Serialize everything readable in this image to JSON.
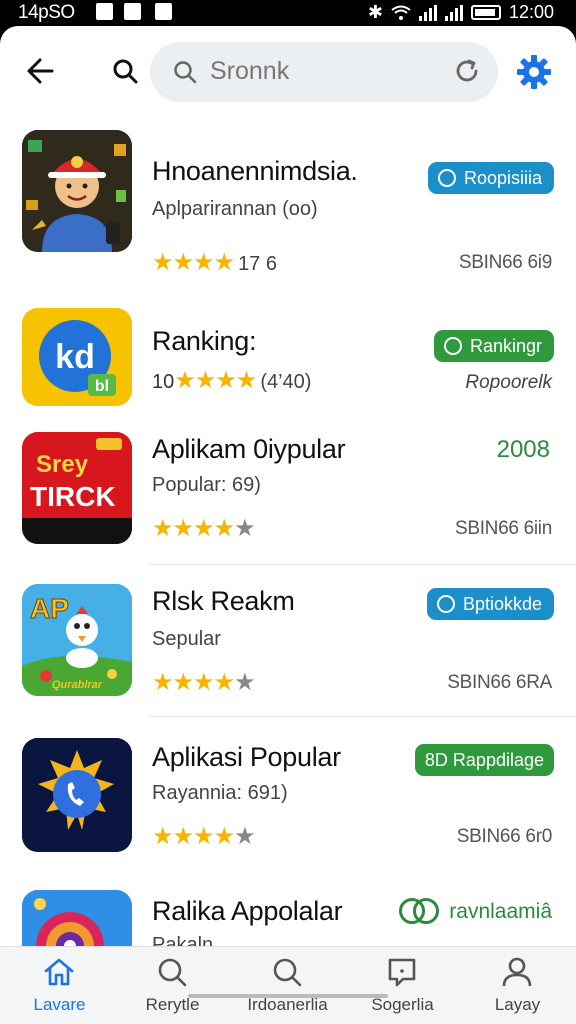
{
  "status_bar": {
    "time": "14pSO",
    "clock": "12:00"
  },
  "search": {
    "placeholder": "Sronnk"
  },
  "apps": [
    {
      "name": "Hnoanennimdsia.",
      "sub": "Aplparirannan (oo)",
      "stars_filled": 4,
      "stars_shown": 4,
      "star_count": "17 6",
      "right_text": "SBIN66 6i9",
      "badge": {
        "label": "Roopisiiia",
        "color": "#1a8fc9"
      }
    },
    {
      "name": "Ranking:",
      "sub_prefix": "10",
      "sub_suffix": "(4’40)",
      "stars_filled": 4,
      "stars_shown": 4,
      "right_text": "Ropoorelk",
      "badge": {
        "label": "Rankingr",
        "color": "#2e9a3c"
      }
    },
    {
      "name": "Aplikam 0iypular",
      "sub": "Popular: 69)",
      "stars_filled": 4,
      "stars_shown": 5,
      "right_text": "SBIN66 6iin",
      "year": "2008",
      "icon_text_top": "Srey",
      "icon_text_main": "TIRCK"
    },
    {
      "name": "Rlsk Reakm",
      "sub": "Sepular",
      "stars_filled": 4,
      "stars_shown": 5,
      "right_text": "SBIN66 6RA",
      "badge": {
        "label": "Bptiokkde",
        "color": "#1a8fc9"
      },
      "icon_text_top": "AP",
      "icon_text_main": "Qurablrar"
    },
    {
      "name": "Aplikasi Popular",
      "sub": "Rayannia: 691)",
      "stars_filled": 4,
      "stars_shown": 5,
      "right_text": "SBIN66 6r0",
      "badge": {
        "label": "8D Rappdilage",
        "color": "#2e9a3c"
      }
    },
    {
      "name": "Ralika Appolalar",
      "sub": "Pakaln",
      "right_text": "ravnlaamiâ"
    }
  ],
  "nav": [
    {
      "label": "Lavare",
      "icon": "home-icon",
      "active": true
    },
    {
      "label": "Rerytle",
      "icon": "search-icon",
      "active": false
    },
    {
      "label": "Irdoanerlia",
      "icon": "search-icon",
      "active": false
    },
    {
      "label": "Sogerlia",
      "icon": "chat-icon",
      "active": false
    },
    {
      "label": "Layay",
      "icon": "person-icon",
      "active": false
    }
  ],
  "colors": {
    "accent": "#1a73e8",
    "star": "#f7b500",
    "badge_blue": "#1a8fc9",
    "badge_green": "#2e9a3c"
  }
}
